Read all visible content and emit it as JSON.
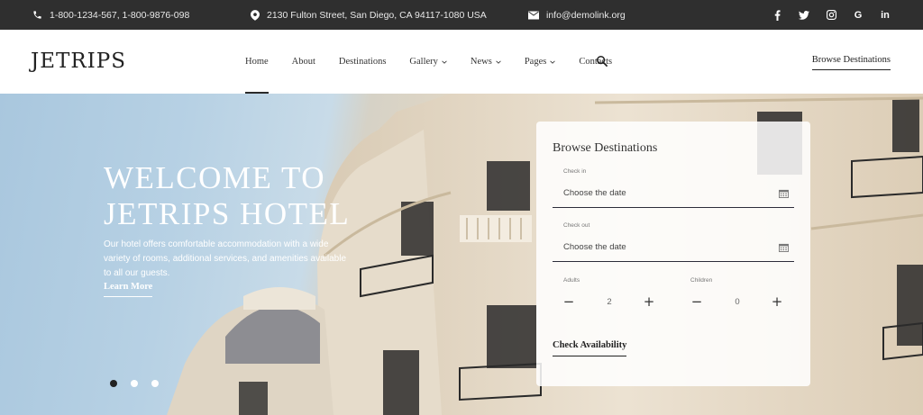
{
  "topbar": {
    "phone": "1-800-1234-567, 1-800-9876-098",
    "address": "2130 Fulton Street, San Diego, CA 94117-1080 USA",
    "email": "info@demolink.org",
    "social_google": "G",
    "social_linkedin": "in"
  },
  "header": {
    "logo": "JETRIPS",
    "nav": {
      "home": "Home",
      "about": "About",
      "destinations": "Destinations",
      "gallery": "Gallery",
      "news": "News",
      "pages": "Pages",
      "contacts": "Contacts"
    },
    "browse": "Browse Destinations"
  },
  "hero": {
    "title": "WELCOME TO JETRIPS HOTEL",
    "description": "Our hotel offers comfortable accommodation with a wide variety of rooms, additional services, and amenities available to all our guests.",
    "learn_more": "Learn More"
  },
  "booking": {
    "title": "Browse Destinations",
    "checkin_label": "Check in",
    "checkin_placeholder": "Choose the date",
    "checkout_label": "Check out",
    "checkout_placeholder": "Choose the date",
    "adults_label": "Adults",
    "adults_value": "2",
    "children_label": "Children",
    "children_value": "0",
    "submit": "Check Availability"
  },
  "colors": {
    "topbar_bg": "#2f2f2f",
    "accent": "#2c2c3a",
    "sky": "#b7d1e4",
    "building": "#e8dcc8"
  }
}
